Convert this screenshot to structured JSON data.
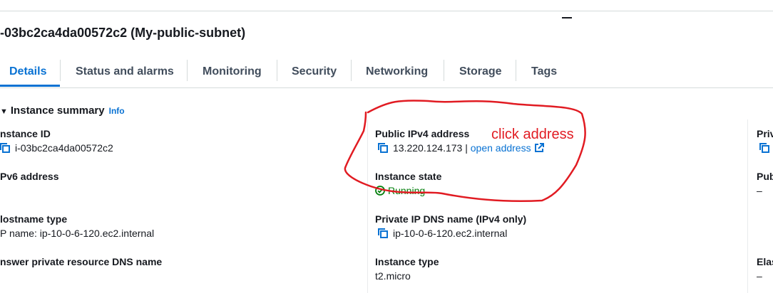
{
  "header": {
    "title": "-03bc2ca4da00572c2 (My-public-subnet)"
  },
  "tabs": [
    {
      "label": "Details",
      "active": true
    },
    {
      "label": "Status and alarms"
    },
    {
      "label": "Monitoring"
    },
    {
      "label": "Security"
    },
    {
      "label": "Networking"
    },
    {
      "label": "Storage"
    },
    {
      "label": "Tags"
    }
  ],
  "summary": {
    "title": "Instance summary",
    "info_label": "Info"
  },
  "col1": {
    "instance_id_label": "nstance ID",
    "instance_id_value": "i-03bc2ca4da00572c2",
    "ipv6_label": "Pv6 address",
    "hostname_label": "lostname type",
    "hostname_value": "P name: ip-10-0-6-120.ec2.internal",
    "answer_dns_label": "nswer private resource DNS name"
  },
  "col2": {
    "public_ipv4_label": "Public IPv4 address",
    "public_ipv4_value": "13.220.124.173",
    "separator": "|",
    "open_address_label": "open address",
    "instance_state_label": "Instance state",
    "instance_state_value": "Running",
    "private_dns_label": "Private IP DNS name (IPv4 only)",
    "private_dns_value": "ip-10-0-6-120.ec2.internal",
    "instance_type_label": "Instance type",
    "instance_type_value": "t2.micro"
  },
  "col3": {
    "label1": "Priv",
    "label2": "Pub",
    "value2": "–",
    "label3": "Elas",
    "value3": "–"
  },
  "annotation": {
    "text": "click address",
    "color": "#e11b22"
  },
  "colors": {
    "accent": "#0972d3",
    "success": "#037f0c"
  }
}
